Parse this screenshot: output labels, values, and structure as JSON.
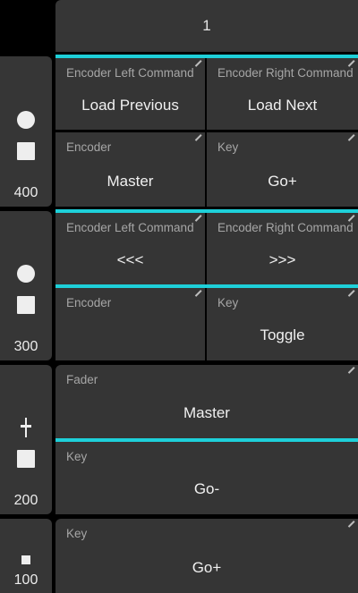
{
  "header": {
    "title": "1"
  },
  "sections": [
    {
      "number": "400",
      "icons": [
        "circle-icon",
        "square-icon"
      ],
      "cells": [
        {
          "label": "Encoder Left Command",
          "value": "Load Previous"
        },
        {
          "label": "Encoder Right Command",
          "value": "Load Next"
        },
        {
          "label": "Encoder",
          "value": "Master"
        },
        {
          "label": "Key",
          "value": "Go+"
        }
      ]
    },
    {
      "number": "300",
      "icons": [
        "circle-icon",
        "square-icon"
      ],
      "cells": [
        {
          "label": "Encoder Left Command",
          "value": "<<<"
        },
        {
          "label": "Encoder Right Command",
          "value": ">>>"
        },
        {
          "label": "Encoder",
          "value": ""
        },
        {
          "label": "Key",
          "value": "Toggle"
        }
      ]
    },
    {
      "number": "200",
      "icons": [
        "fader-icon",
        "square-icon"
      ],
      "cells": [
        {
          "label": "Fader",
          "value": "Master"
        },
        {
          "label": "Key",
          "value": "Go-"
        }
      ]
    },
    {
      "number": "100",
      "icons": [
        "small-square-icon"
      ],
      "cells": [
        {
          "label": "Key",
          "value": "Go+"
        }
      ]
    }
  ],
  "colors": {
    "accent": "#1ed0d9",
    "panel": "#363636",
    "background": "#000000"
  }
}
